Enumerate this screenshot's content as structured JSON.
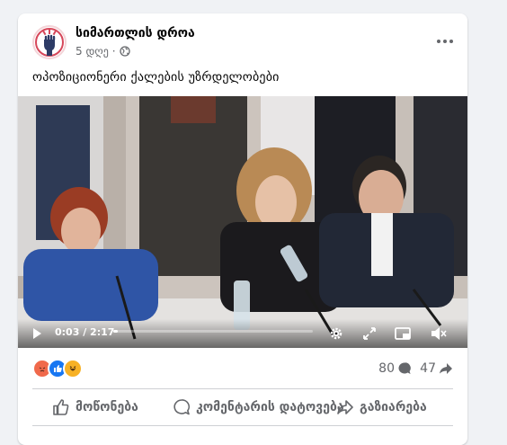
{
  "post": {
    "page_name": "სიმართლის დროა",
    "time": "5 დღე",
    "separator": "·",
    "privacy_icon": "globe-icon",
    "text": "ოპოზიციონერი ქალების უზრდელობები"
  },
  "video": {
    "time_display": "0:03 / 2:17",
    "progress_fraction": 0.022,
    "icons": [
      "play-icon",
      "settings-icon",
      "fullscreen-icon",
      "picture-in-picture-icon",
      "mute-icon"
    ]
  },
  "stats": {
    "reactions": [
      "angry",
      "like",
      "haha"
    ],
    "comments_count": "80",
    "shares_count": "47"
  },
  "actions": {
    "like_label": "მოწონება",
    "comment_label": "კომენტარის დატოვება",
    "share_label": "გაზიარება"
  },
  "colors": {
    "angry": "#f0694b",
    "like": "#1877f2",
    "haha": "#f7b125",
    "text_secondary": "#65676b"
  }
}
